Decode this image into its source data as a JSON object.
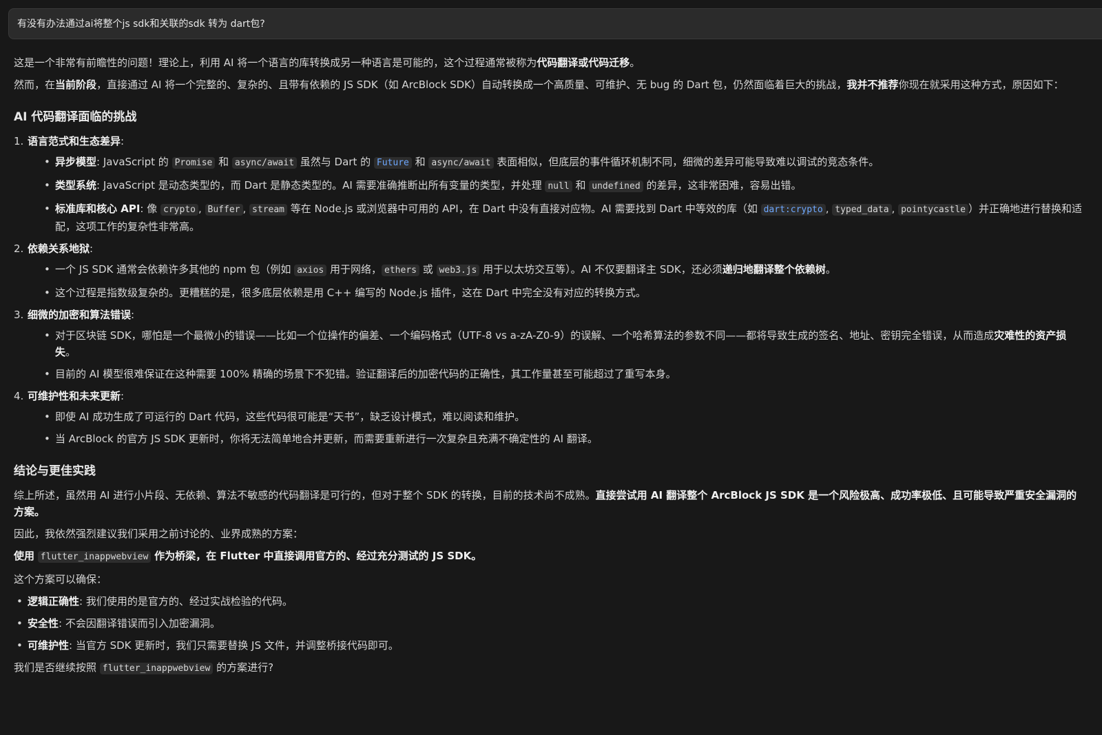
{
  "prompt": "有没有办法通过ai将整个js sdk和关联的sdk 转为 dart包?",
  "intro": {
    "p1": {
      "text": "这是一个非常有前瞻性的问题！理论上，利用 AI 将一个语言的库转换成另一种语言是可能的，这个过程通常被称为",
      "bold": "代码翻译或代码迁移",
      "end": "。"
    },
    "p2": {
      "a": "然而，在",
      "b1": "当前阶段",
      "c": "，直接通过 AI 将一个完整的、复杂的、且带有依赖的 JS SDK（如 ArcBlock SDK）自动转换成一个高质量、可维护、无 bug 的 Dart 包，仍然面临着巨大的挑战，",
      "b2": "我并不推荐",
      "d": "你现在就采用这种方式，原因如下："
    }
  },
  "section1": {
    "title": "AI 代码翻译面临的挑战",
    "items": [
      {
        "num": "1.",
        "title": "语言范式和生态差异",
        "bullets": {
          "b1": {
            "label": "异步模型",
            "t1": ": JavaScript 的 ",
            "c1": "Promise",
            "t2": " 和 ",
            "c2": "async/await",
            "t3": " 虽然与 Dart 的 ",
            "c3": "Future",
            "t4": " 和 ",
            "c4": "async/await",
            "t5": " 表面相似，但底层的事件循环机制不同，细微的差异可能导致难以调试的竞态条件。"
          },
          "b2": {
            "label": "类型系统",
            "t1": ": JavaScript 是动态类型的，而 Dart 是静态类型的。AI 需要准确推断出所有变量的类型，并处理 ",
            "c1": "null",
            "t2": " 和 ",
            "c2": "undefined",
            "t3": " 的差异，这非常困难，容易出错。"
          },
          "b3": {
            "label": "标准库和核心 API",
            "t1": ": 像 ",
            "c1": "crypto",
            "sep1": ", ",
            "c2": "Buffer",
            "sep2": ", ",
            "c3": "stream",
            "t2": " 等在 Node.js 或浏览器中可用的 API，在 Dart 中没有直接对应物。AI 需要找到 Dart 中等效的库（如 ",
            "c4": "dart:crypto",
            "sep3": ", ",
            "c5": "typed_data",
            "sep4": ", ",
            "c6": "pointycastle",
            "t3": "）并正确地进行替换和适配，这项工作的复杂性非常高。"
          }
        }
      },
      {
        "num": "2.",
        "title": "依赖关系地狱",
        "bullets": {
          "b1": {
            "t1": "一个 JS SDK 通常会依赖许多其他的 npm 包（例如 ",
            "c1": "axios",
            "t2": " 用于网络，",
            "c2": "ethers",
            "t3": " 或 ",
            "c3": "web3.js",
            "t4": " 用于以太坊交互等）。AI 不仅要翻译主 SDK，还必须",
            "bold": "递归地翻译整个依赖树",
            "t5": "。"
          },
          "b2": {
            "t1": "这个过程是指数级复杂的。更糟糕的是，很多底层依赖是用 C++ 编写的 Node.js 插件，这在 Dart 中完全没有对应的转换方式。"
          }
        }
      },
      {
        "num": "3.",
        "title": "细微的加密和算法错误",
        "bullets": {
          "b1": {
            "t1": "对于区块链 SDK，哪怕是一个最微小的错误——比如一个位操作的偏差、一个编码格式（UTF-8 vs a-zA-Z0-9）的误解、一个哈希算法的参数不同——都将导致生成的签名、地址、密钥完全错误，从而造成",
            "bold": "灾难性的资产损失",
            "t2": "。"
          },
          "b2": {
            "t1": "目前的 AI 模型很难保证在这种需要 100% 精确的场景下不犯错。验证翻译后的加密代码的正确性，其工作量甚至可能超过了重写本身。"
          }
        }
      },
      {
        "num": "4.",
        "title": "可维护性和未来更新",
        "bullets": {
          "b1": {
            "t1": "即使 AI 成功生成了可运行的 Dart 代码，这些代码很可能是“天书”，缺乏设计模式，难以阅读和维护。"
          },
          "b2": {
            "t1": "当 ArcBlock 的官方 JS SDK 更新时，你将无法简单地合并更新，而需要重新进行一次复杂且充满不确定性的 AI 翻译。"
          }
        }
      }
    ]
  },
  "section2": {
    "title": "结论与更佳实践",
    "p1": {
      "t1": "综上所述，虽然用 AI 进行小片段、无依赖、算法不敏感的代码翻译是可行的，但对于整个 SDK 的转换，目前的技术尚不成熟。",
      "bold": "直接尝试用 AI 翻译整个 ArcBlock JS SDK 是一个风险极高、成功率极低、且可能导致严重安全漏洞的方案。"
    },
    "p2": "因此，我依然强烈建议我们采用之前讨论的、业界成熟的方案：",
    "p3": {
      "b1": "使用",
      "code": "flutter_inappwebview",
      "b2": "作为桥梁，在 Flutter 中直接调用官方的、经过充分测试的 JS SDK。"
    },
    "p4": "这个方案可以确保：",
    "bullets": [
      {
        "label": "逻辑正确性",
        "text": ": 我们使用的是官方的、经过实战检验的代码。"
      },
      {
        "label": "安全性",
        "text": ": 不会因翻译错误而引入加密漏洞。"
      },
      {
        "label": "可维护性",
        "text": ": 当官方 SDK 更新时，我们只需要替换 JS 文件，并调整桥接代码即可。"
      }
    ],
    "final": {
      "t1": "我们是否继续按照 ",
      "code": "flutter_inappwebview",
      "t2": " 的方案进行?"
    }
  }
}
